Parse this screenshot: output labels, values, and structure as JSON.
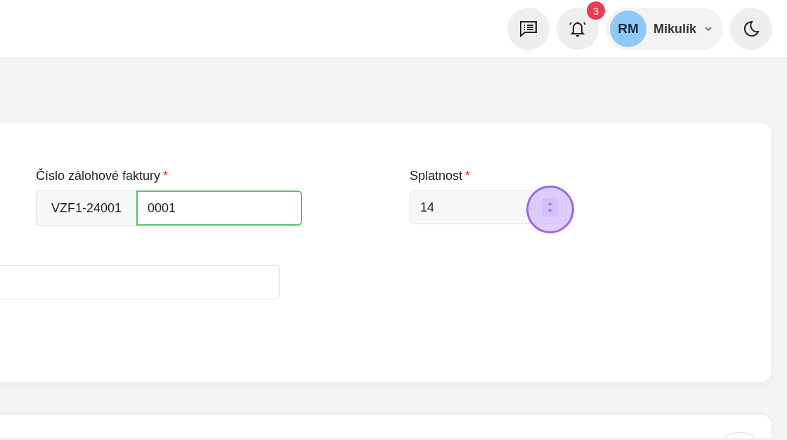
{
  "header": {
    "notifications": {
      "count": "3"
    },
    "user": {
      "initials": "RM",
      "name": "Mikulík"
    }
  },
  "form": {
    "fields": [
      {
        "kind": "prefixed",
        "label": "Číslo zálohové faktury",
        "required_mark": "*",
        "prefix": "VZF1-24001",
        "value": "0001",
        "focused": true
      },
      {
        "kind": "number",
        "label": "Splatnost",
        "required_mark": "*",
        "value": "14",
        "focused": false,
        "spinner_highlighted": true
      },
      {
        "kind": "text",
        "focused": false
      }
    ]
  }
}
